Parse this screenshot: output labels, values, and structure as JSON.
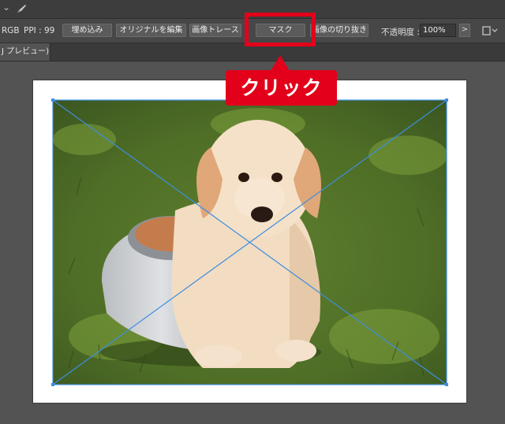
{
  "control_bar": {
    "color_info": "RGB",
    "ppi": "PPI : 99",
    "embed_label": "埋め込み",
    "edit_original_label": "オリジナルを編集",
    "image_trace_label": "画像トレース",
    "mask_label": "マスク",
    "crop_image_label": "画像の切り抜き",
    "opacity_label": "不透明度 :",
    "opacity_value": "100%",
    "arrow_glyph": ">"
  },
  "tab": {
    "label": "J プレビュー)"
  },
  "annotation": {
    "callout_text": "クリック"
  },
  "colors": {
    "accent_red": "#e2001a",
    "selection_blue": "#3d8ee0"
  },
  "icons": {
    "top_chevron": "chevron-down-icon",
    "top_brush": "brush-icon",
    "artboard_options": "artboard-options-icon"
  }
}
